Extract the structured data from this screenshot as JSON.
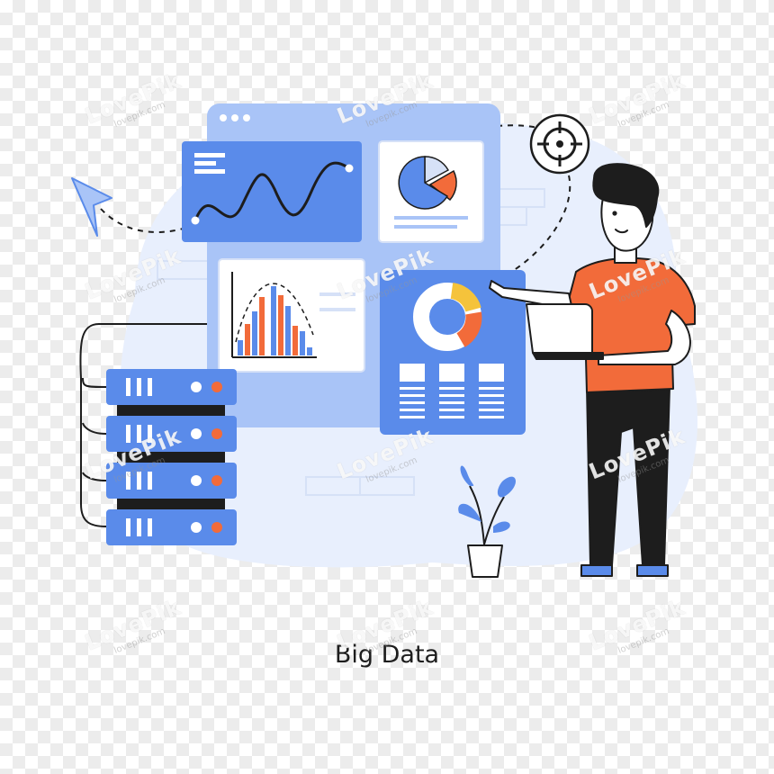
{
  "caption": "Big Data",
  "watermark": {
    "brand": "LovePik",
    "site": "lovepik.com"
  },
  "colors": {
    "primary_blue": "#5a8bea",
    "light_blue": "#a9c4f7",
    "pale_blue": "#e8effd",
    "orange": "#f26b3a",
    "yellow": "#f5c33b",
    "outline": "#1d1d1d",
    "skin": "#ffffff"
  },
  "icons": [
    "browser-window",
    "line-chart-card",
    "pie-chart-card",
    "bar-chart-card",
    "donut-chart-card",
    "server-stack-icon",
    "cursor-arrow-icon",
    "target-icon",
    "potted-plant",
    "man-with-laptop"
  ]
}
